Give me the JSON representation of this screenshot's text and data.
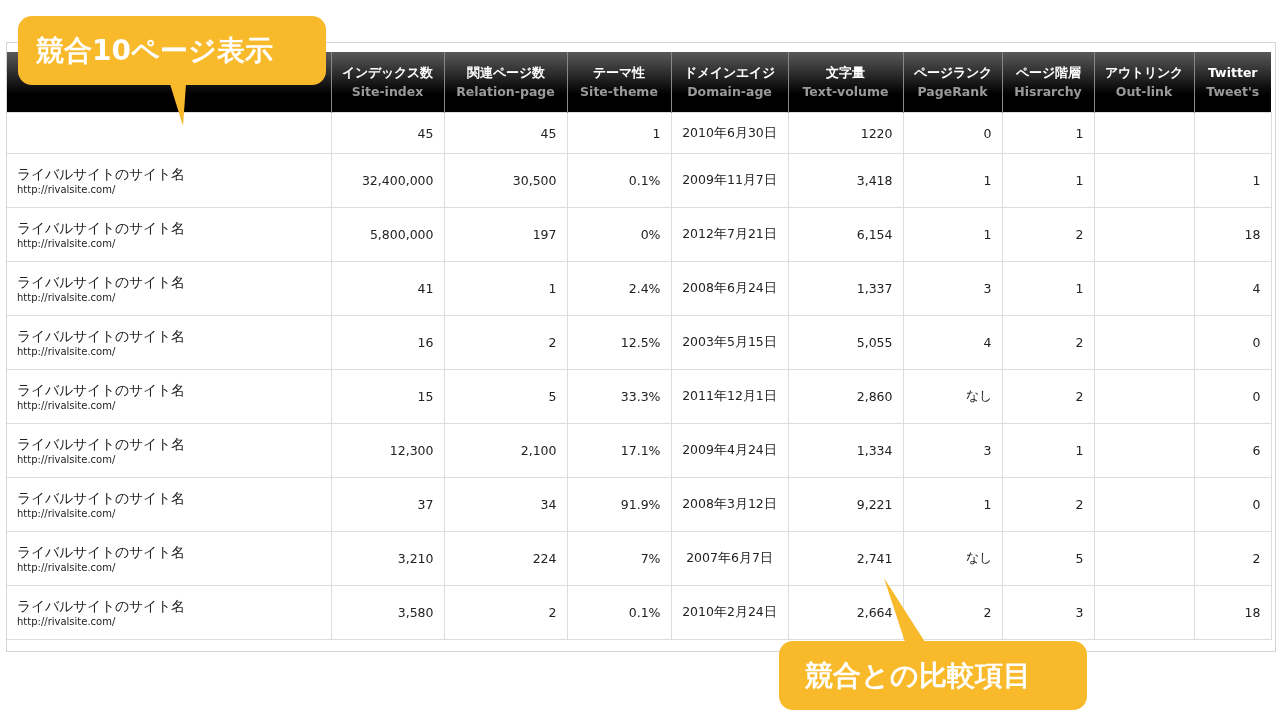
{
  "table": {
    "columns": [
      {},
      {
        "label": "インデックス数",
        "sublabel": "Site-index"
      },
      {
        "label": "関連ページ数",
        "sublabel": "Relation-page"
      },
      {
        "label": "テーマ性",
        "sublabel": "Site-theme"
      },
      {
        "label": "ドメインエイジ",
        "sublabel": "Domain-age"
      },
      {
        "label": "文字量",
        "sublabel": "Text-volume"
      },
      {
        "label": "ページランク",
        "sublabel": "PageRank"
      },
      {
        "label": "ページ階層",
        "sublabel": "Hisrarchy"
      },
      {
        "label": "アウトリンク",
        "sublabel": "Out-link"
      },
      {
        "label": "Twitter",
        "sublabel": "Tweet's"
      }
    ],
    "rows": [
      {
        "cells": [
          null,
          "45",
          "45",
          "1",
          "2010年6月30日",
          "1220",
          "0",
          "1",
          null,
          null
        ]
      },
      {
        "cells": [
          {
            "name": "ライバルサイトのサイト名",
            "url": "http://rivalsite.com/"
          },
          "32,400,000",
          "30,500",
          "0.1%",
          "2009年11月7日",
          "3,418",
          "1",
          "1",
          null,
          "1"
        ]
      },
      {
        "cells": [
          {
            "name": "ライバルサイトのサイト名",
            "url": "http://rivalsite.com/"
          },
          "5,800,000",
          "197",
          "0%",
          "2012年7月21日",
          "6,154",
          "1",
          "2",
          null,
          "18"
        ]
      },
      {
        "cells": [
          {
            "name": "ライバルサイトのサイト名",
            "url": "http://rivalsite.com/"
          },
          "41",
          "1",
          "2.4%",
          "2008年6月24日",
          "1,337",
          "3",
          "1",
          null,
          "4"
        ]
      },
      {
        "cells": [
          {
            "name": "ライバルサイトのサイト名",
            "url": "http://rivalsite.com/"
          },
          "16",
          "2",
          "12.5%",
          "2003年5月15日",
          "5,055",
          "4",
          "2",
          null,
          "0"
        ]
      },
      {
        "cells": [
          {
            "name": "ライバルサイトのサイト名",
            "url": "http://rivalsite.com/"
          },
          "15",
          "5",
          "33.3%",
          "2011年12月1日",
          "2,860",
          "なし",
          "2",
          null,
          "0"
        ]
      },
      {
        "cells": [
          {
            "name": "ライバルサイトのサイト名",
            "url": "http://rivalsite.com/"
          },
          "12,300",
          "2,100",
          "17.1%",
          "2009年4月24日",
          "1,334",
          "3",
          "1",
          null,
          "6"
        ]
      },
      {
        "cells": [
          {
            "name": "ライバルサイトのサイト名",
            "url": "http://rivalsite.com/"
          },
          "37",
          "34",
          "91.9%",
          "2008年3月12日",
          "9,221",
          "1",
          "2",
          null,
          "0"
        ]
      },
      {
        "cells": [
          {
            "name": "ライバルサイトのサイト名",
            "url": "http://rivalsite.com/"
          },
          "3,210",
          "224",
          "7%",
          "2007年6月7日",
          "2,741",
          "なし",
          "5",
          null,
          "2"
        ]
      },
      {
        "cells": [
          {
            "name": "ライバルサイトのサイト名",
            "url": "http://rivalsite.com/"
          },
          "3,580",
          "2",
          "0.1%",
          "2010年2月24日",
          "2,664",
          "2",
          "3",
          null,
          "18"
        ]
      }
    ]
  },
  "callouts": [
    {
      "kind": "top",
      "text": "競合10ページ表示"
    },
    {
      "kind": "bottom",
      "text": "競合との比較項目"
    }
  ]
}
